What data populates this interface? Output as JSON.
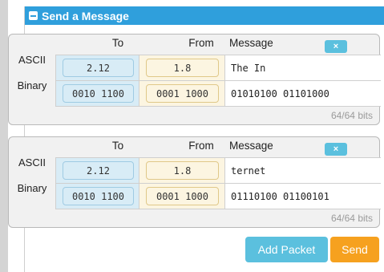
{
  "panel": {
    "title": "Send a Message"
  },
  "packets": [
    {
      "headers": {
        "to": "To",
        "from": "From",
        "message": "Message"
      },
      "remove_label": "×",
      "rows": {
        "ascii_label": "ASCII",
        "binary_label": "Binary"
      },
      "ascii": {
        "to": "2.12",
        "from": "1.8",
        "message": "The In"
      },
      "binary": {
        "to": "0010 1100",
        "from": "0001 1000",
        "message": "01010100 01101000"
      },
      "bits": "64/64 bits"
    },
    {
      "headers": {
        "to": "To",
        "from": "From",
        "message": "Message"
      },
      "remove_label": "×",
      "rows": {
        "ascii_label": "ASCII",
        "binary_label": "Binary"
      },
      "ascii": {
        "to": "2.12",
        "from": "1.8",
        "message": "ternet"
      },
      "binary": {
        "to": "0010 1100",
        "from": "0001 1000",
        "message": "01110100 01100101"
      },
      "bits": "64/64 bits"
    }
  ],
  "actions": {
    "add_packet": "Add Packet",
    "send": "Send"
  },
  "colors": {
    "header_blue": "#2f9fdc",
    "add_button": "#5bc0de",
    "send_button": "#f6a11f"
  }
}
